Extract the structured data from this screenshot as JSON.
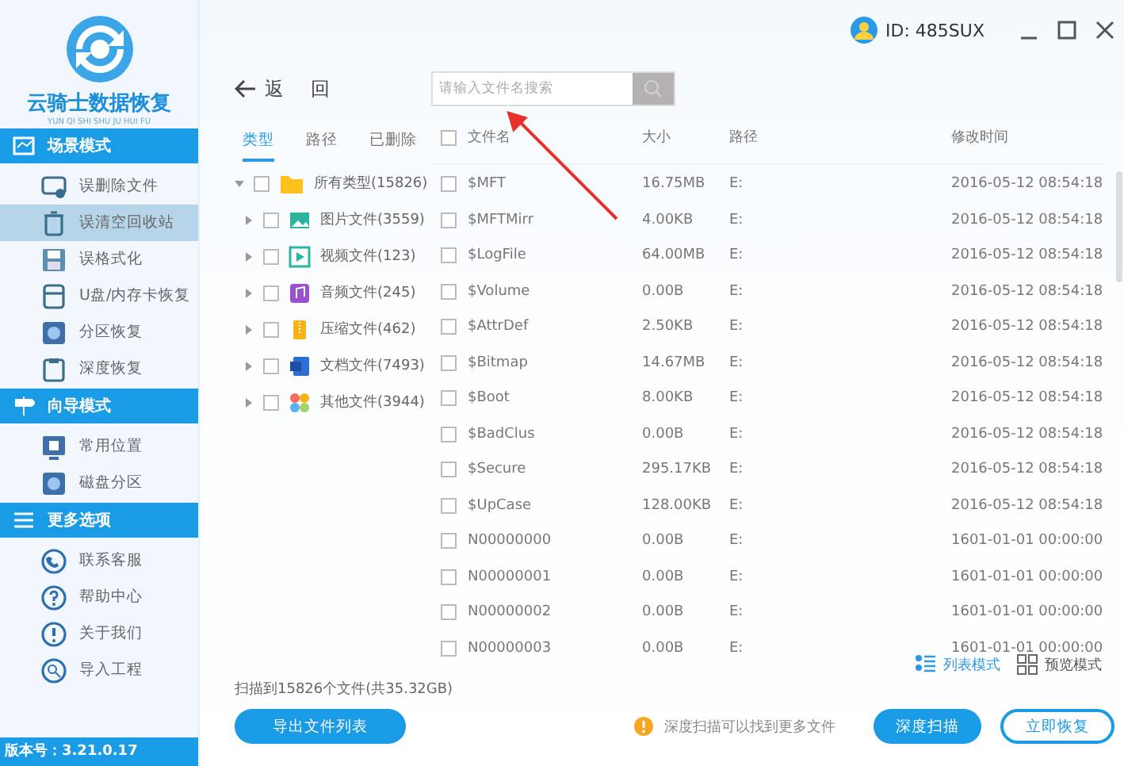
{
  "sidebar": {
    "app_name": "云骑士数据恢复",
    "app_subtitle": "YUN QI SHI SHU JU HUI FU",
    "sections": [
      {
        "title": "场景模式",
        "items": [
          {
            "label": "误删除文件",
            "selected": false
          },
          {
            "label": "误清空回收站",
            "selected": true
          },
          {
            "label": "误格式化",
            "selected": false
          },
          {
            "label": "U盘/内存卡恢复",
            "selected": false
          },
          {
            "label": "分区恢复",
            "selected": false
          },
          {
            "label": "深度恢复",
            "selected": false
          }
        ]
      },
      {
        "title": "向导模式",
        "items": [
          {
            "label": "常用位置",
            "selected": false
          },
          {
            "label": "磁盘分区",
            "selected": false
          }
        ]
      },
      {
        "title": "更多选项",
        "items": [
          {
            "label": "联系客服",
            "selected": false
          },
          {
            "label": "帮助中心",
            "selected": false
          },
          {
            "label": "关于我们",
            "selected": false
          },
          {
            "label": "导入工程",
            "selected": false
          }
        ]
      }
    ],
    "version": "版本号：3.21.0.17"
  },
  "header": {
    "user_id": "ID: 485SUX"
  },
  "toolbar": {
    "back": "返",
    "back_2": "回",
    "search": {
      "placeholder": "请输入文件名搜索"
    }
  },
  "filter_tabs": [
    {
      "label": "类型",
      "selected": true
    },
    {
      "label": "路径",
      "selected": false
    },
    {
      "label": "已删除",
      "selected": false
    }
  ],
  "tree": [
    {
      "label": "所有类型(15826)",
      "expanded": true,
      "checked": false,
      "children": [
        {
          "label": "图片文件(3559)",
          "expanded": false,
          "checked": false
        },
        {
          "label": "视频文件(123)",
          "expanded": false,
          "checked": false
        },
        {
          "label": "音频文件(245)",
          "expanded": false,
          "checked": false
        },
        {
          "label": "压缩文件(462)",
          "expanded": false,
          "checked": false
        },
        {
          "label": "文档文件(7493)",
          "expanded": false,
          "checked": false
        },
        {
          "label": "其他文件(3944)",
          "expanded": false,
          "checked": false
        }
      ]
    }
  ],
  "table": {
    "columns": [
      "文件名",
      "大小",
      "路径",
      "修改时间"
    ],
    "header_checked": false,
    "rows": [
      {
        "name": "$MFT",
        "size": "16.75MB",
        "path": "E:",
        "modified": "2016-05-12 08:54:18",
        "checked": false
      },
      {
        "name": "$MFTMirr",
        "size": "4.00KB",
        "path": "E:",
        "modified": "2016-05-12 08:54:18",
        "checked": false
      },
      {
        "name": "$LogFile",
        "size": "64.00MB",
        "path": "E:",
        "modified": "2016-05-12 08:54:18",
        "checked": false
      },
      {
        "name": "$Volume",
        "size": "0.00B",
        "path": "E:",
        "modified": "2016-05-12 08:54:18",
        "checked": false
      },
      {
        "name": "$AttrDef",
        "size": "2.50KB",
        "path": "E:",
        "modified": "2016-05-12 08:54:18",
        "checked": false
      },
      {
        "name": "$Bitmap",
        "size": "14.67MB",
        "path": "E:",
        "modified": "2016-05-12 08:54:18",
        "checked": false
      },
      {
        "name": "$Boot",
        "size": "8.00KB",
        "path": "E:",
        "modified": "2016-05-12 08:54:18",
        "checked": false
      },
      {
        "name": "$BadClus",
        "size": "0.00B",
        "path": "E:",
        "modified": "2016-05-12 08:54:18",
        "checked": false
      },
      {
        "name": "$Secure",
        "size": "295.17KB",
        "path": "E:",
        "modified": "2016-05-12 08:54:18",
        "checked": false
      },
      {
        "name": "$UpCase",
        "size": "128.00KB",
        "path": "E:",
        "modified": "2016-05-12 08:54:18",
        "checked": false
      },
      {
        "name": "N00000000",
        "size": "0.00B",
        "path": "E:",
        "modified": "1601-01-01 00:00:00",
        "checked": false
      },
      {
        "name": "N00000001",
        "size": "0.00B",
        "path": "E:",
        "modified": "1601-01-01 00:00:00",
        "checked": false
      },
      {
        "name": "N00000002",
        "size": "0.00B",
        "path": "E:",
        "modified": "1601-01-01 00:00:00",
        "checked": false
      },
      {
        "name": "N00000003",
        "size": "0.00B",
        "path": "E:",
        "modified": "1601-01-01 00:00:00",
        "checked": false
      }
    ]
  },
  "view_modes": [
    {
      "label": "列表模式",
      "selected": true
    },
    {
      "label": "预览模式",
      "selected": false
    }
  ],
  "footer": {
    "scan_summary": "扫描到15826个文件(共35.32GB)",
    "export_button": "导出文件列表",
    "hint": "深度扫描可以找到更多文件",
    "buttons": [
      "深度扫描",
      "立即恢复"
    ]
  }
}
